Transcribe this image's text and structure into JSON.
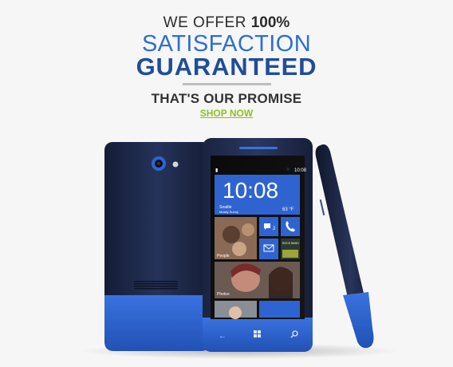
{
  "promo": {
    "line1": "WE OFFER ",
    "line1_percent": "100%",
    "line2": "SATISFACTION",
    "line3": "GUARANTEED",
    "promise": "THAT'S OUR PROMISE",
    "cta": "SHOP NOW"
  },
  "phone_screen": {
    "time": "10:08",
    "status_time": "10:08",
    "city": "Seattle",
    "weather_desc": "Mostly Sunny",
    "temperature": "63 °F",
    "people_label": "People",
    "messages_count": "2",
    "photos_label": "Photos",
    "tile_caption": "ROCK BASH"
  },
  "colors": {
    "accent_blue": "#2d6fd0",
    "dark_blue": "#1f4e99",
    "cta_green": "#8ec21e",
    "phone_navy": "#1e2a4a",
    "phone_blue": "#2f64d0"
  },
  "icons": [
    "back-icon",
    "windows-icon",
    "search-icon",
    "phone-icon",
    "message-icon",
    "mail-icon",
    "camera-icon"
  ]
}
